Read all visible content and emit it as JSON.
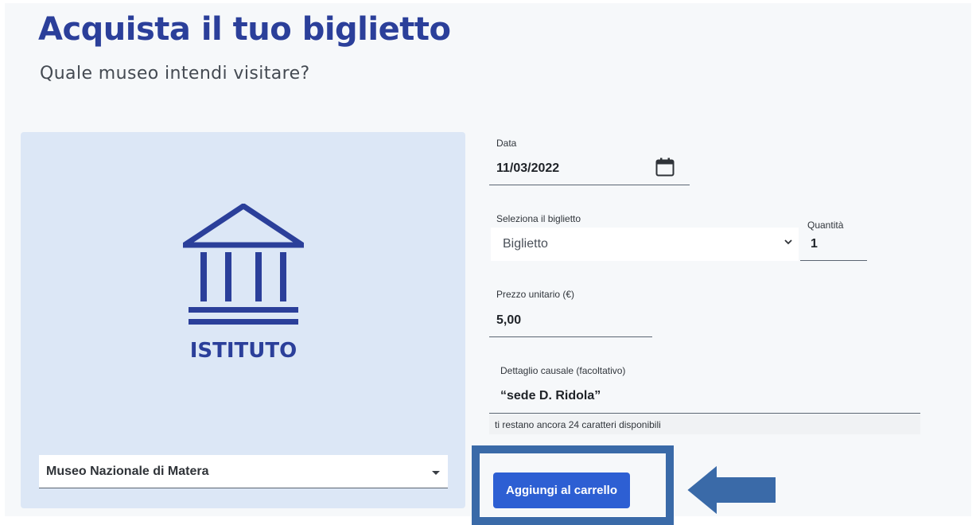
{
  "page": {
    "title": "Acquista il tuo biglietto",
    "subtitle": "Quale museo intendi visitare?"
  },
  "museum": {
    "icon": "museum-building-icon",
    "label": "ISTITUTO",
    "selected": "Museo Nazionale di Matera"
  },
  "form": {
    "date": {
      "label": "Data",
      "value": "11/03/2022",
      "icon": "calendar-icon"
    },
    "ticket": {
      "label": "Seleziona il biglietto",
      "value": "Biglietto",
      "icon": "chevron-down-icon"
    },
    "quantity": {
      "label": "Quantità",
      "value": "1"
    },
    "price": {
      "label": "Prezzo unitario (€)",
      "value": "5,00"
    },
    "detail": {
      "label": "Dettaglio causale (facoltativo)",
      "value": "“sede D. Ridola”",
      "counter": "ti restano ancora 24 caratteri disponibili"
    }
  },
  "actions": {
    "add_to_cart": "Aggiungi al carrello"
  },
  "colors": {
    "brand": "#2b3f9a",
    "button": "#2d5fd3",
    "highlight": "#3a6aa8",
    "panel": "#dce7f6"
  }
}
